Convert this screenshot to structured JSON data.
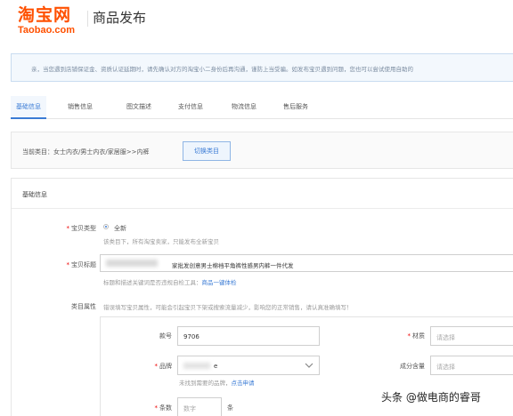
{
  "header": {
    "logo_cn": "淘宝网",
    "logo_en": "Taobao.com",
    "title": "商品发布"
  },
  "notice": {
    "text": "亲，当您遇到店铺保证金、资质认证延期时，请先确认对方的淘宝小二身份后再沟通，谨防上当受骗。如发布宝贝遇到问题，您也可以尝试使用自助的"
  },
  "tabs": [
    {
      "label": "基础信息",
      "active": true
    },
    {
      "label": "销售信息",
      "active": false
    },
    {
      "label": "图文描述",
      "active": false
    },
    {
      "label": "支付信息",
      "active": false
    },
    {
      "label": "物流信息",
      "active": false
    },
    {
      "label": "售后服务",
      "active": false
    }
  ],
  "category": {
    "text": "当前类目：女士内衣/男士内衣/家居服>>内裤",
    "switch_label": "切换类目"
  },
  "section": {
    "title": "基础信息"
  },
  "form": {
    "item_type_label": "宝贝类型",
    "item_type_value": "全新",
    "item_type_hint": "该类目下，所有淘宝卖家，只能发布全新宝贝",
    "item_title_label": "宝贝标题",
    "item_title_value": "家批发创意男士棉裆平角裤性感男内裤一件代发",
    "item_title_hint": "标题和描述关键词是否违规自检工具：",
    "item_title_link": "商品一键体检",
    "attr_label": "类目属性",
    "attr_hint": "错误填写宝贝属性，可能会引起宝贝下架或搜索流量减少，影响您的正常销售，请认真准确填写！"
  },
  "attributes": {
    "model_label": "款号",
    "model_value": "9706",
    "material_label": "材质",
    "material_placeholder": "请选择",
    "brand_label": "品牌",
    "brand_suffix": "e",
    "brand_hint": "未找到需要的品牌，",
    "brand_hint_link": "点击申请",
    "content_label": "成分含量",
    "content_placeholder": "请选择",
    "count_label": "条数",
    "count_placeholder": "数字",
    "count_unit": "条"
  },
  "watermark": {
    "text": "头条 @做电商的睿哥"
  },
  "colors": {
    "brand": "#ff5000",
    "accent": "#3a7bd5",
    "required": "#ee0000"
  }
}
